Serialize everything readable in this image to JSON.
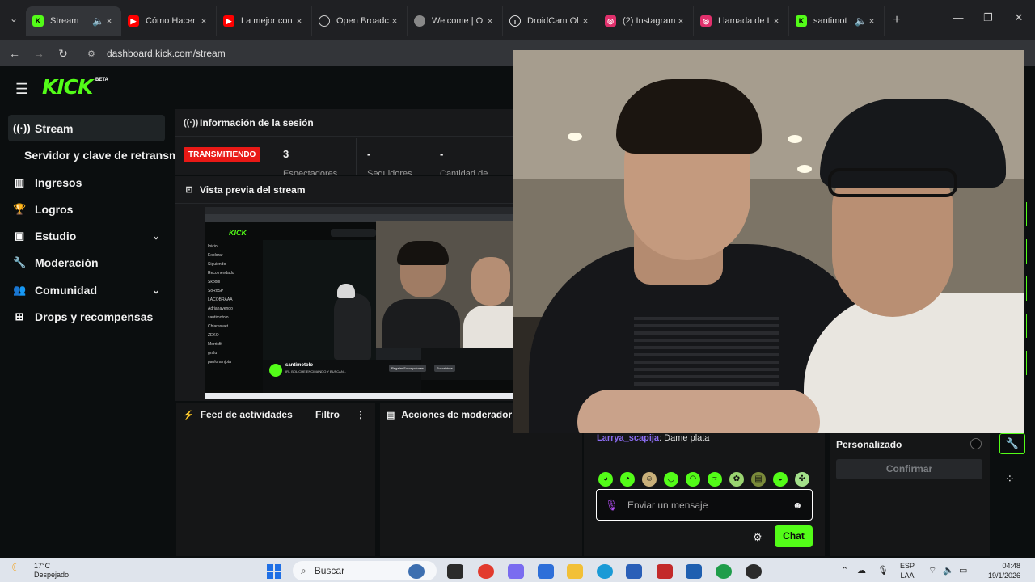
{
  "browser": {
    "tabs": [
      {
        "title": "Stream",
        "favicon": "kick-icon",
        "color": "#53fc18",
        "active": true
      },
      {
        "title": "Cómo Hacer",
        "favicon": "youtube-icon",
        "color": "#ff0000"
      },
      {
        "title": "La mejor con",
        "favicon": "youtube-icon",
        "color": "#ff0000"
      },
      {
        "title": "Open Broadc",
        "favicon": "obs-icon",
        "color": "#d8d8d8"
      },
      {
        "title": "Welcome | O",
        "favicon": "globe-icon",
        "color": "#9a9a9a"
      },
      {
        "title": "DroidCam Ol",
        "favicon": "droidcam-icon",
        "color": "#eeeeee"
      },
      {
        "title": "(2) Instagram",
        "favicon": "instagram-icon",
        "color": "#e1306c"
      },
      {
        "title": "Llamada de I",
        "favicon": "instagram-icon",
        "color": "#e1306c"
      },
      {
        "title": "santimot",
        "favicon": "kick-icon",
        "color": "#53fc18"
      }
    ],
    "url": "dashboard.kick.com/stream"
  },
  "site": {
    "logo": "KICK",
    "beta": "BETA"
  },
  "sidebar": {
    "items": [
      {
        "label": "Stream",
        "icon": "broadcast-icon"
      },
      {
        "label": "Servidor y clave de retransm"
      },
      {
        "label": "Ingresos",
        "icon": "chart-icon"
      },
      {
        "label": "Logros",
        "icon": "trophy-icon"
      },
      {
        "label": "Estudio",
        "icon": "studio-icon"
      },
      {
        "label": "Moderación",
        "icon": "wrench-icon"
      },
      {
        "label": "Comunidad",
        "icon": "people-icon"
      },
      {
        "label": "Drops y recompensas",
        "icon": "drops-icon"
      }
    ]
  },
  "session": {
    "title": "Información de la sesión",
    "status": "TRANSMITIENDO",
    "stats": [
      {
        "value": "3",
        "label": "Espectadores"
      },
      {
        "value": "-",
        "label": "Seguidores"
      },
      {
        "value": "-",
        "label": "Cantidad de"
      }
    ]
  },
  "preview": {
    "title": "Vista previa del stream",
    "stream_title": "santimotolo",
    "stream_subtitle": "IRL BOLICHE ENCIMANDO Y BUSCAN...",
    "sidebar_items": [
      "Inicio",
      "Explorar",
      "Siguiendo",
      "Recomendado",
      "Skoobi",
      "SoRoSP",
      "LACOBRAAA",
      "Adrianavendo",
      "santimotolo",
      "Chiaraswet",
      "ZEKO",
      "Morrisfit",
      "gralu",
      "paoloramjota"
    ],
    "buttons": [
      "Regalar Suscripciones",
      "Suscribirse"
    ]
  },
  "feed": {
    "title": "Feed de actividades",
    "filter": "Filtro"
  },
  "moderator": {
    "title": "Acciones de moderador"
  },
  "chat": {
    "message_user": "Larrya_scapija",
    "message_text": ": Dame plata",
    "placeholder": "Enviar un mensaje",
    "send_label": "Chat"
  },
  "custom": {
    "label": "Personalizado",
    "confirm": "Confirmar"
  },
  "taskbar": {
    "temperature": "17°C",
    "weather": "Despejado",
    "search": "Buscar",
    "language": "ESP",
    "layout": "LAA",
    "time": "04:48",
    "date": "19/1/2026"
  }
}
